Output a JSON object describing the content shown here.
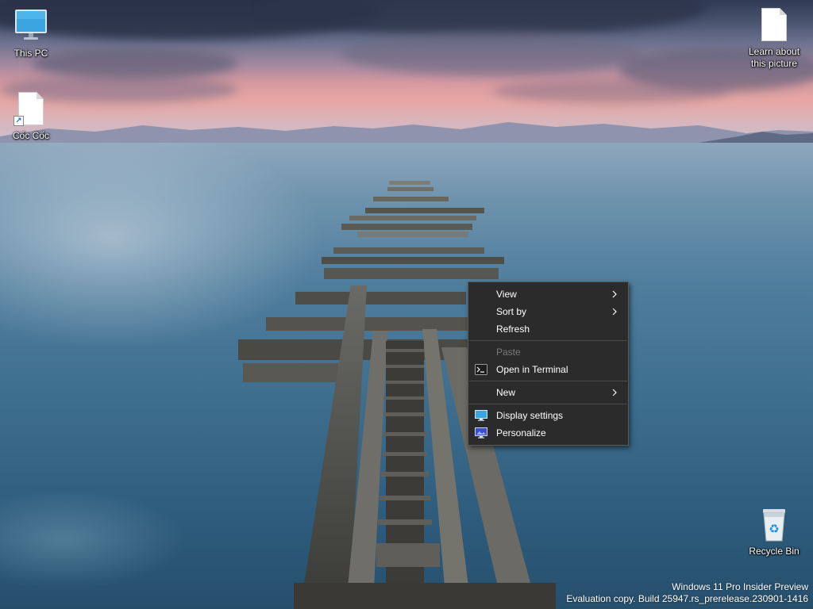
{
  "desktop": {
    "icons": {
      "this_pc": {
        "label": "This PC",
        "icon": "monitor-icon"
      },
      "coc_coc": {
        "label": "Cốc Cốc",
        "icon": "document-shortcut-icon"
      },
      "learn_picture": {
        "label": "Learn about this picture",
        "icon": "document-icon"
      },
      "recycle_bin": {
        "label": "Recycle Bin",
        "icon": "recycle-bin-icon"
      }
    }
  },
  "context_menu": {
    "view": {
      "label": "View",
      "has_submenu": true
    },
    "sort_by": {
      "label": "Sort by",
      "has_submenu": true
    },
    "refresh": {
      "label": "Refresh"
    },
    "paste": {
      "label": "Paste",
      "disabled": true
    },
    "open_terminal": {
      "label": "Open in Terminal",
      "icon": "terminal-icon"
    },
    "new": {
      "label": "New",
      "has_submenu": true
    },
    "display_settings": {
      "label": "Display settings",
      "icon": "display-settings-icon"
    },
    "personalize": {
      "label": "Personalize",
      "icon": "personalize-icon"
    }
  },
  "watermark": {
    "line1": "Windows 11 Pro Insider Preview",
    "line2": "Evaluation copy. Build 25947.rs_prerelease.230901-1416"
  },
  "colors": {
    "menu_bg": "#2b2b2b",
    "menu_border": "#5a5a5a",
    "menu_text": "#ffffff",
    "menu_disabled_text": "#7a7a7a",
    "monitor_accent": "#3aa5e0"
  }
}
